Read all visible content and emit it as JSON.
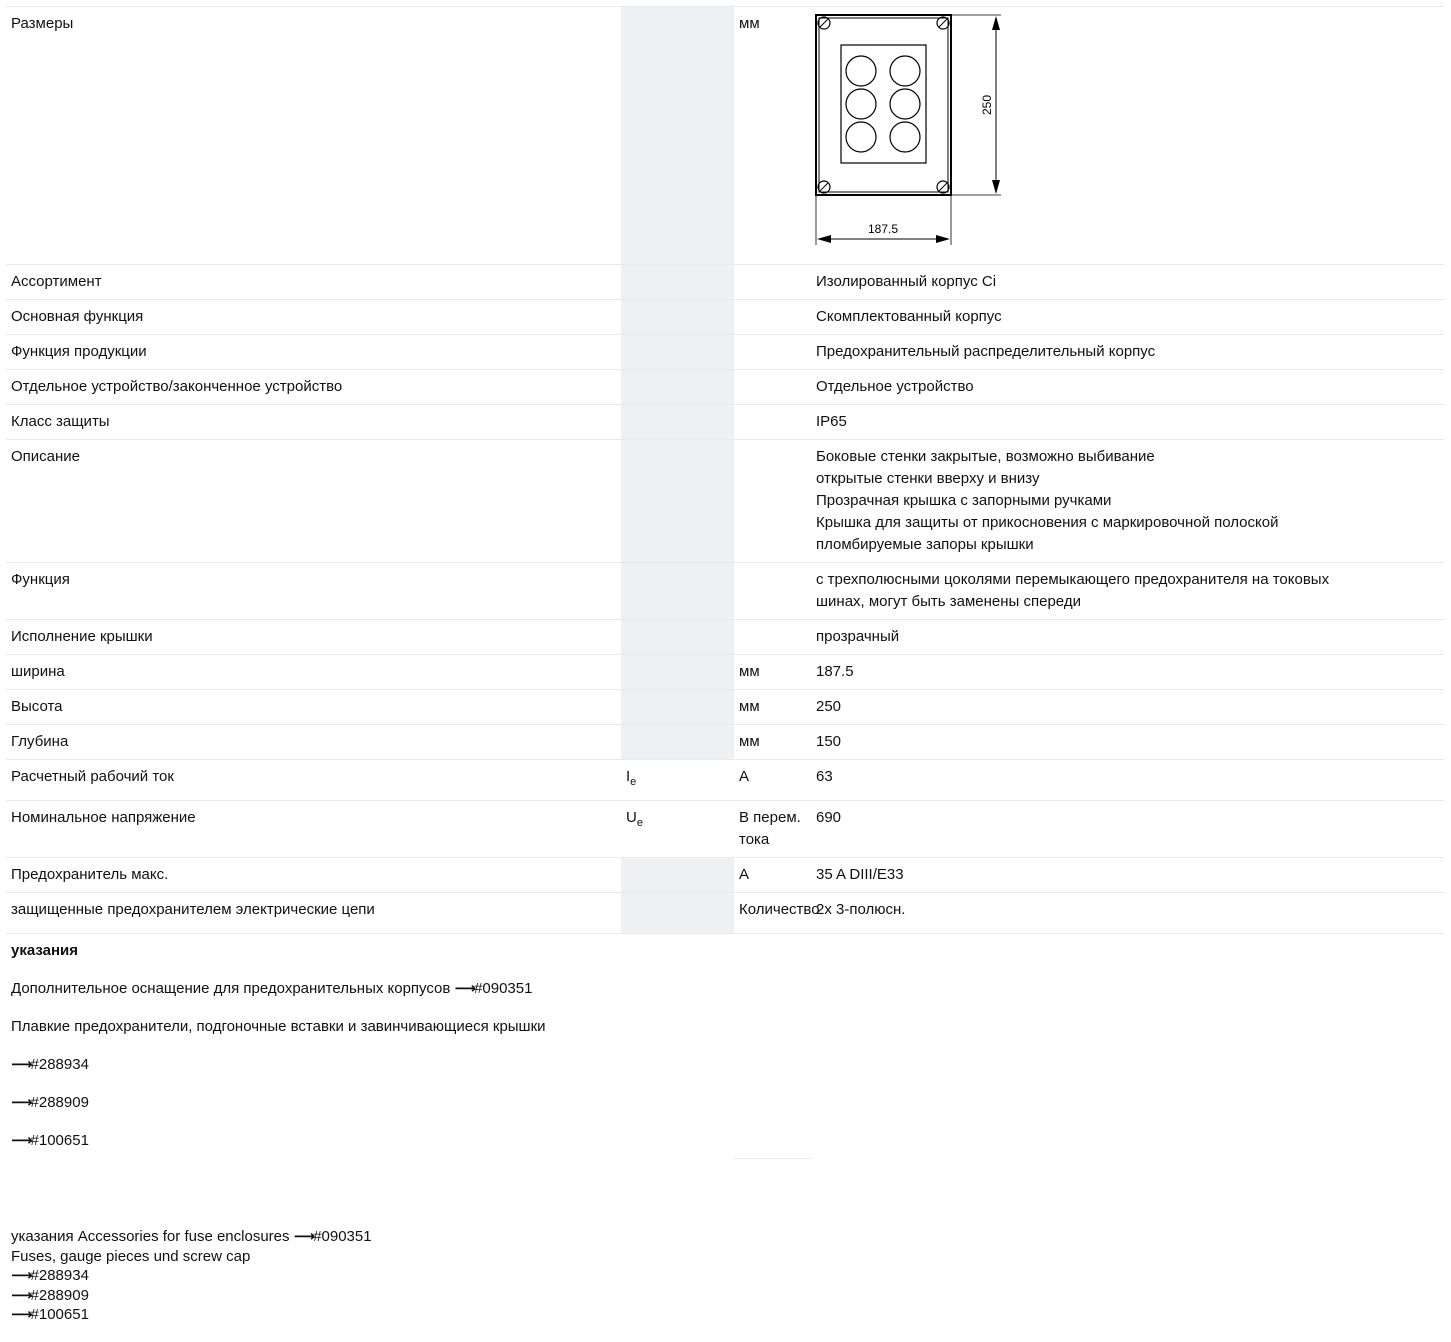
{
  "rows": [
    {
      "label": "Размеры",
      "symbol": "",
      "unit": "мм",
      "value": ""
    },
    {
      "label": "Ассортимент",
      "symbol": "",
      "unit": "",
      "value": "Изолированный корпус Ci"
    },
    {
      "label": "Основная функция",
      "symbol": "",
      "unit": "",
      "value": "Скомплектованный корпус"
    },
    {
      "label": "Функция продукции",
      "symbol": "",
      "unit": "",
      "value": "Предохранительный распределительный корпус"
    },
    {
      "label": "Отдельное устройство/законченное устройство",
      "symbol": "",
      "unit": "",
      "value": "Отдельное устройство"
    },
    {
      "label": "Класс защиты",
      "symbol": "",
      "unit": "",
      "value": "IP65"
    },
    {
      "label": "Описание",
      "symbol": "",
      "unit": "",
      "value_lines": [
        "Боковые стенки закрытые, возможно выбивание",
        "открытые стенки вверху и внизу",
        "Прозрачная крышка с запорными ручками",
        "Крышка для защиты от прикосновения с маркировочной полоской",
        "пломбируемые запоры крышки"
      ]
    },
    {
      "label": "Функция",
      "symbol": "",
      "unit": "",
      "value_lines": [
        "с трехполюсными цоколями перемыкающего предохранителя на токовых",
        "шинах, могут быть заменены спереди"
      ]
    },
    {
      "label": "Исполнение крышки",
      "symbol": "",
      "unit": "",
      "value": "прозрачный"
    },
    {
      "label": "ширина",
      "symbol": "",
      "unit": "мм",
      "value": "187.5"
    },
    {
      "label": "Высота",
      "symbol": "",
      "unit": "мм",
      "value": "250"
    },
    {
      "label": "Глубина",
      "symbol": "",
      "unit": "мм",
      "value": "150"
    },
    {
      "label": "Расчетный рабочий ток",
      "symbol": "I",
      "symbol_sub": "e",
      "unit": "A",
      "value": "63"
    },
    {
      "label": "Номинальное напряжение",
      "symbol": "U",
      "symbol_sub": "e",
      "unit": "В перем. тока",
      "value": "690"
    },
    {
      "label": "Предохранитель макс.",
      "symbol": "",
      "unit": "A",
      "value": "35 A DIII/E33"
    },
    {
      "label": "защищенные предохранителем электрические цепи",
      "symbol": "",
      "unit": "Количество",
      "value": "2x 3-полюсн."
    }
  ],
  "drawing": {
    "dim_height": "250",
    "dim_width": "187.5"
  },
  "notes": {
    "heading": "указания",
    "line1_text": "Дополнительное оснащение для предохранительных корпусов ",
    "line1_ref": "#090351",
    "line2_text": "Плавкие предохранители, подгоночные вставки и завинчивающиеся крышки",
    "refs": [
      "#288934",
      "#288909",
      "#100651"
    ]
  },
  "bottom": {
    "prefix": "указания Accessories for fuse enclosures ",
    "ref1": "#090351",
    "line2": "Fuses, gauge pieces und screw cap",
    "refs": [
      "#288934",
      "#288909",
      "#100651"
    ]
  },
  "arrow_glyph": "⟶"
}
